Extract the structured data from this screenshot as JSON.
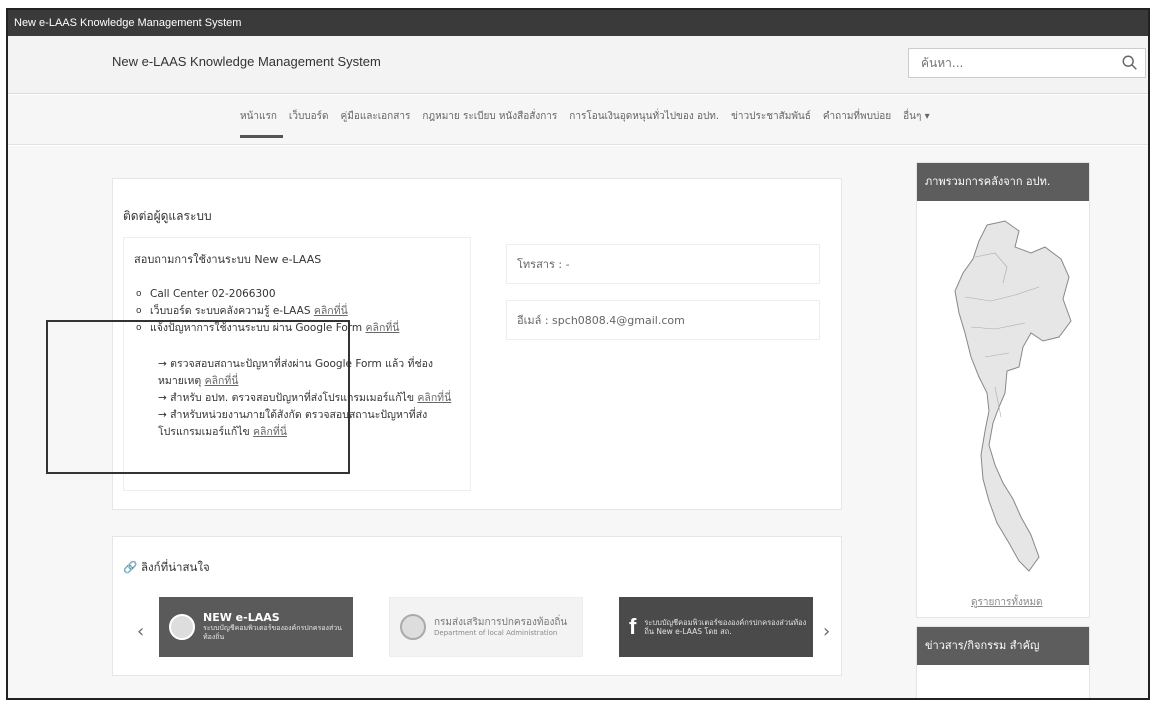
{
  "window": {
    "title": "New e-LAAS Knowledge Management System"
  },
  "header": {
    "brand": "New e-LAAS Knowledge Management System",
    "search_placeholder": "ค้นหา..."
  },
  "nav": {
    "items": [
      {
        "label": "หน้าแรก",
        "active": true
      },
      {
        "label": "เว็บบอร์ด",
        "active": false
      },
      {
        "label": "คู่มือและเอกสาร",
        "active": false
      },
      {
        "label": "กฎหมาย ระเบียบ หนังสือสั่งการ",
        "active": false
      },
      {
        "label": "การโอนเงินอุดหนุนทั่วไปของ อปท.",
        "active": false
      },
      {
        "label": "ข่าวประชาสัมพันธ์",
        "active": false
      },
      {
        "label": "คำถามที่พบบ่อย",
        "active": false
      },
      {
        "label": "อื่นๆ ▾",
        "active": false
      }
    ]
  },
  "contact": {
    "title": "ติดต่อผู้ดูแลระบบ",
    "subtitle": "สอบถามการใช้งานระบบ New e-LAAS",
    "items": [
      {
        "text": "Call Center 02-2066300",
        "link": ""
      },
      {
        "text": "เว็บบอร์ด ระบบคลังความรู้ e-LAAS ",
        "link": "คลิกที่นี่"
      },
      {
        "text": "แจ้งปัญหาการใช้งานระบบ ผ่าน Google Form ",
        "link": "คลิกที่นี่"
      }
    ],
    "sublines": [
      {
        "text": "→ ตรวจสอบสถานะปัญหาที่ส่งผ่าน Google Form แล้ว ที่ช่องหมายเหตุ ",
        "link": "คลิกที่นี่"
      },
      {
        "text": "→ สำหรับ อปท. ตรวจสอบปัญหาที่ส่งโปรแกรมเมอร์แก้ไข ",
        "link": "คลิกที่นี่"
      },
      {
        "text": "→ สำหรับหน่วยงานภายใต้สังกัด ตรวจสอบสถานะปัญหาที่ส่งโปรแกรมเมอร์แก้ไข ",
        "link": "คลิกที่นี่"
      }
    ],
    "phone": "โทรสาร : -",
    "email": "อีเมล์ : spch0808.4@gmail.com"
  },
  "links": {
    "title": "ลิงก์ที่น่าสนใจ",
    "banners": [
      {
        "title": "NEW e-LAAS",
        "small": "ระบบบัญชีคอมพิวเตอร์ขององค์กรปกครองส่วนท้องถิ่น"
      },
      {
        "title": "กรมส่งเสริมการปกครองท้องถิ่น",
        "small": "Department of local Administration"
      },
      {
        "title": "f",
        "small": "ระบบบัญชีคอมพิวเตอร์ขององค์กรปกครองส่วนท้องถิ่น New e-LAAS โดย สถ."
      }
    ],
    "prev": "‹",
    "next": "›"
  },
  "sidebar": {
    "map_title": "ภาพรวมการคลังจาก อปท.",
    "map_link": "ดูรายการทั้งหมด",
    "news_title": "ข่าวสาร/กิจกรรม สำคัญ"
  },
  "colors": {
    "header_dark": "#3a3a3a",
    "side_header": "#5d5d5d",
    "banner_dark": "#5a5a5a"
  }
}
